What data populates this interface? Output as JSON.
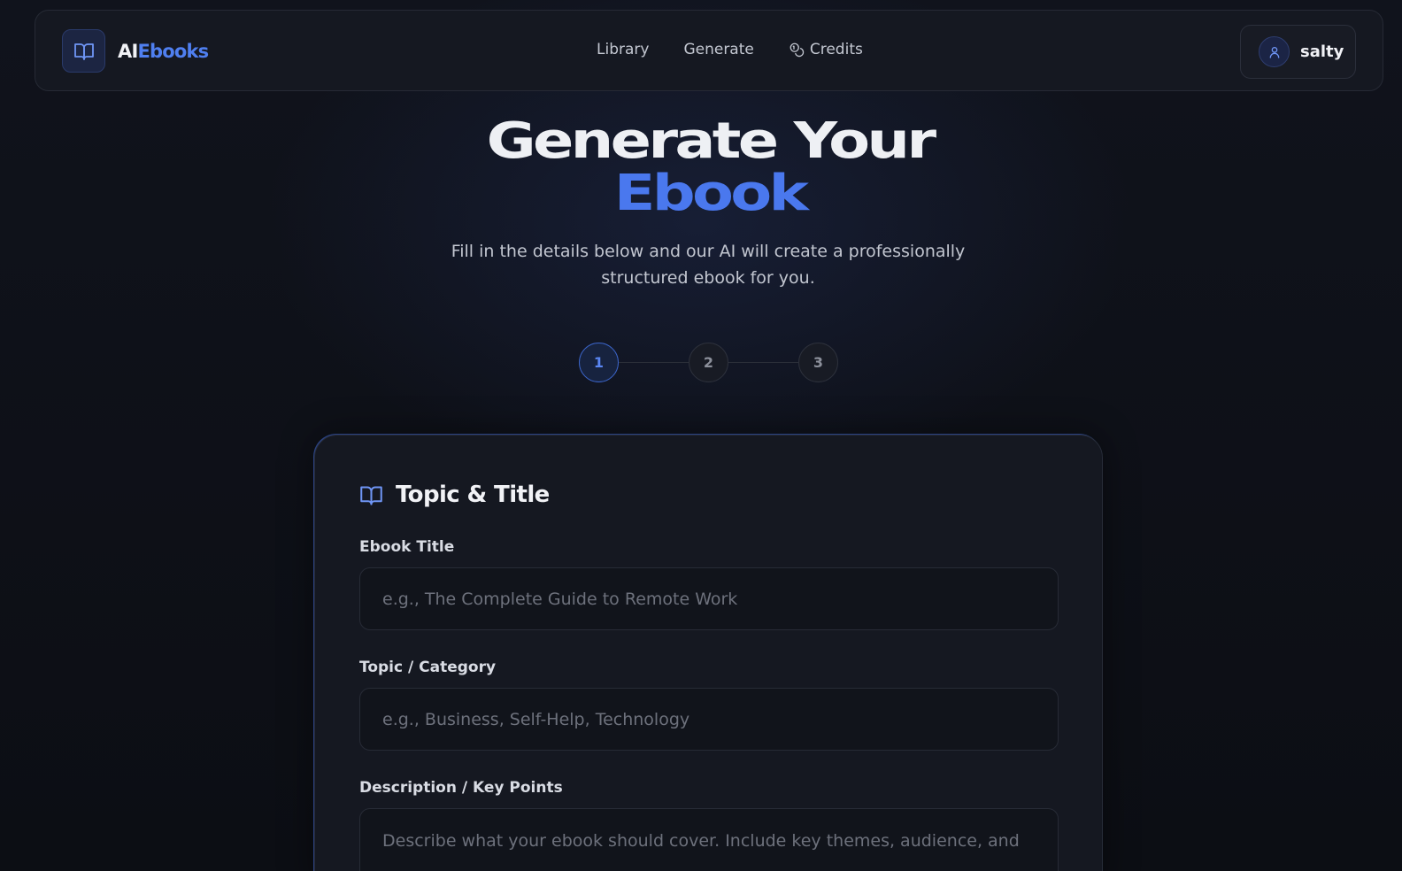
{
  "brand": {
    "name_a": "AI",
    "name_b": "Ebooks"
  },
  "nav": {
    "library": "Library",
    "generate": "Generate",
    "credits": "Credits"
  },
  "user": {
    "name": "salty"
  },
  "hero": {
    "title_line1": "Generate Your",
    "title_line2": "Ebook",
    "subtitle": "Fill in the details below and our AI will create a professionally structured ebook for you."
  },
  "stepper": {
    "steps": [
      "1",
      "2",
      "3"
    ],
    "active_step": 1
  },
  "card": {
    "title": "Topic & Title",
    "fields": [
      {
        "label": "Ebook Title",
        "placeholder": "e.g., The Complete Guide to Remote Work",
        "value": ""
      },
      {
        "label": "Topic / Category",
        "placeholder": "e.g., Business, Self-Help, Technology",
        "value": ""
      },
      {
        "label": "Description / Key Points",
        "placeholder": "Describe what your ebook should cover. Include key themes, audience, and",
        "value": ""
      }
    ]
  },
  "colors": {
    "accent": "#4a78ee",
    "background": "#0d0f15",
    "surface": "#151821"
  },
  "icons": {
    "brand": "book-open-icon",
    "credits": "coins-icon",
    "avatar": "user-icon",
    "card": "book-open-icon"
  }
}
